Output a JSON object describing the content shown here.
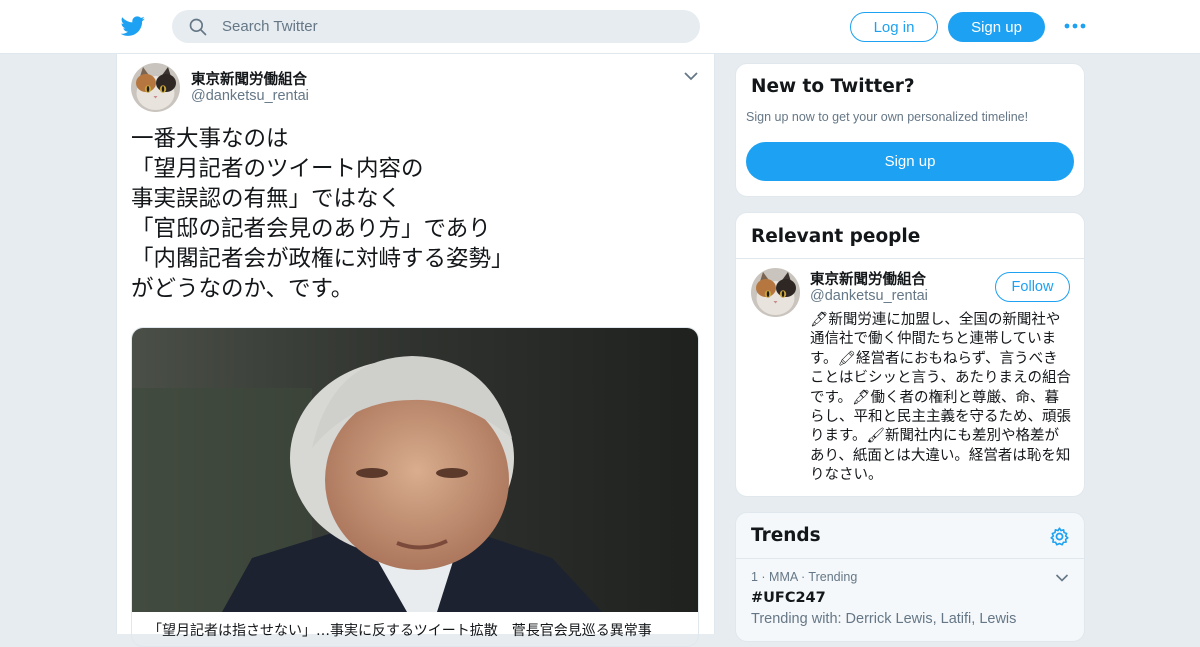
{
  "header": {
    "search_placeholder": "Search Twitter",
    "login_label": "Log in",
    "signup_label": "Sign up",
    "logo_icon": "twitter-bird-icon",
    "more_icon": "more-dots-icon",
    "brand_color": "#1da1f2"
  },
  "tweet": {
    "author_name": "東京新聞労働組合",
    "author_handle": "@danketsu_rentai",
    "text": "一番大事なのは\n「望月記者のツイート内容の\n事実誤認の有無」ではなく\n「官邸の記者会見のあり方」であり\n「内閣記者会が政権に対峙する姿勢」\nがどうなのか、です。",
    "card_title": "「望月記者は指させない」…事実に反するツイート拡散　菅長官会見巡る異常事"
  },
  "sidebar": {
    "new_to_twitter": {
      "title": "New to Twitter?",
      "subtitle": "Sign up now to get your own personalized timeline!",
      "signup_label": "Sign up"
    },
    "relevant_people": {
      "title": "Relevant people",
      "name": "東京新聞労働組合",
      "handle": "@danketsu_rentai",
      "follow_label": "Follow",
      "bio": "🖋新聞労連に加盟し、全国の新聞社や通信社で働く仲間たちと連帯しています。🖍経営者におもねらず、言うべきことはビシッと言う、あたりまえの組合です。🖋働く者の権利と尊厳、命、暮らし、平和と民主主義を守るため、頑張ります。🖌新聞社内にも差別や格差があり、紙面とは大違い。経営者は恥を知りなさい。"
    },
    "trends": {
      "title": "Trends",
      "items": [
        {
          "meta": "1 · MMA · Trending",
          "name": "#UFC247",
          "with": "Trending with: Derrick Lewis, Latifi, Lewis"
        }
      ]
    }
  }
}
